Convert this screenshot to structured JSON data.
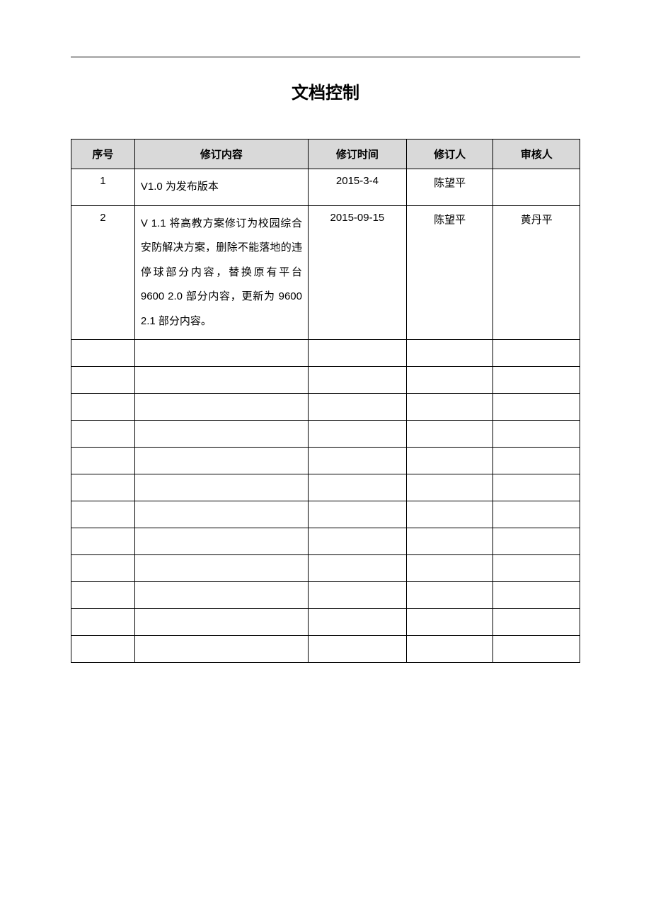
{
  "title": "文档控制",
  "headers": {
    "seq": "序号",
    "content": "修订内容",
    "date": "修订时间",
    "reviser": "修订人",
    "approver": "审核人"
  },
  "rows": [
    {
      "seq": "1",
      "content": "V1.0 为发布版本",
      "date": "2015-3-4",
      "reviser": "陈望平",
      "approver": ""
    },
    {
      "seq": "2",
      "content": "V 1.1 将高教方案修订为校园综合安防解决方案，删除不能落地的违停球部分内容，替换原有平台 9600 2.0 部分内容，更新为 9600 2.1 部分内容。",
      "date": "2015-09-15",
      "reviser": "陈望平",
      "approver": "黄丹平"
    }
  ],
  "emptyRowCount": 12
}
